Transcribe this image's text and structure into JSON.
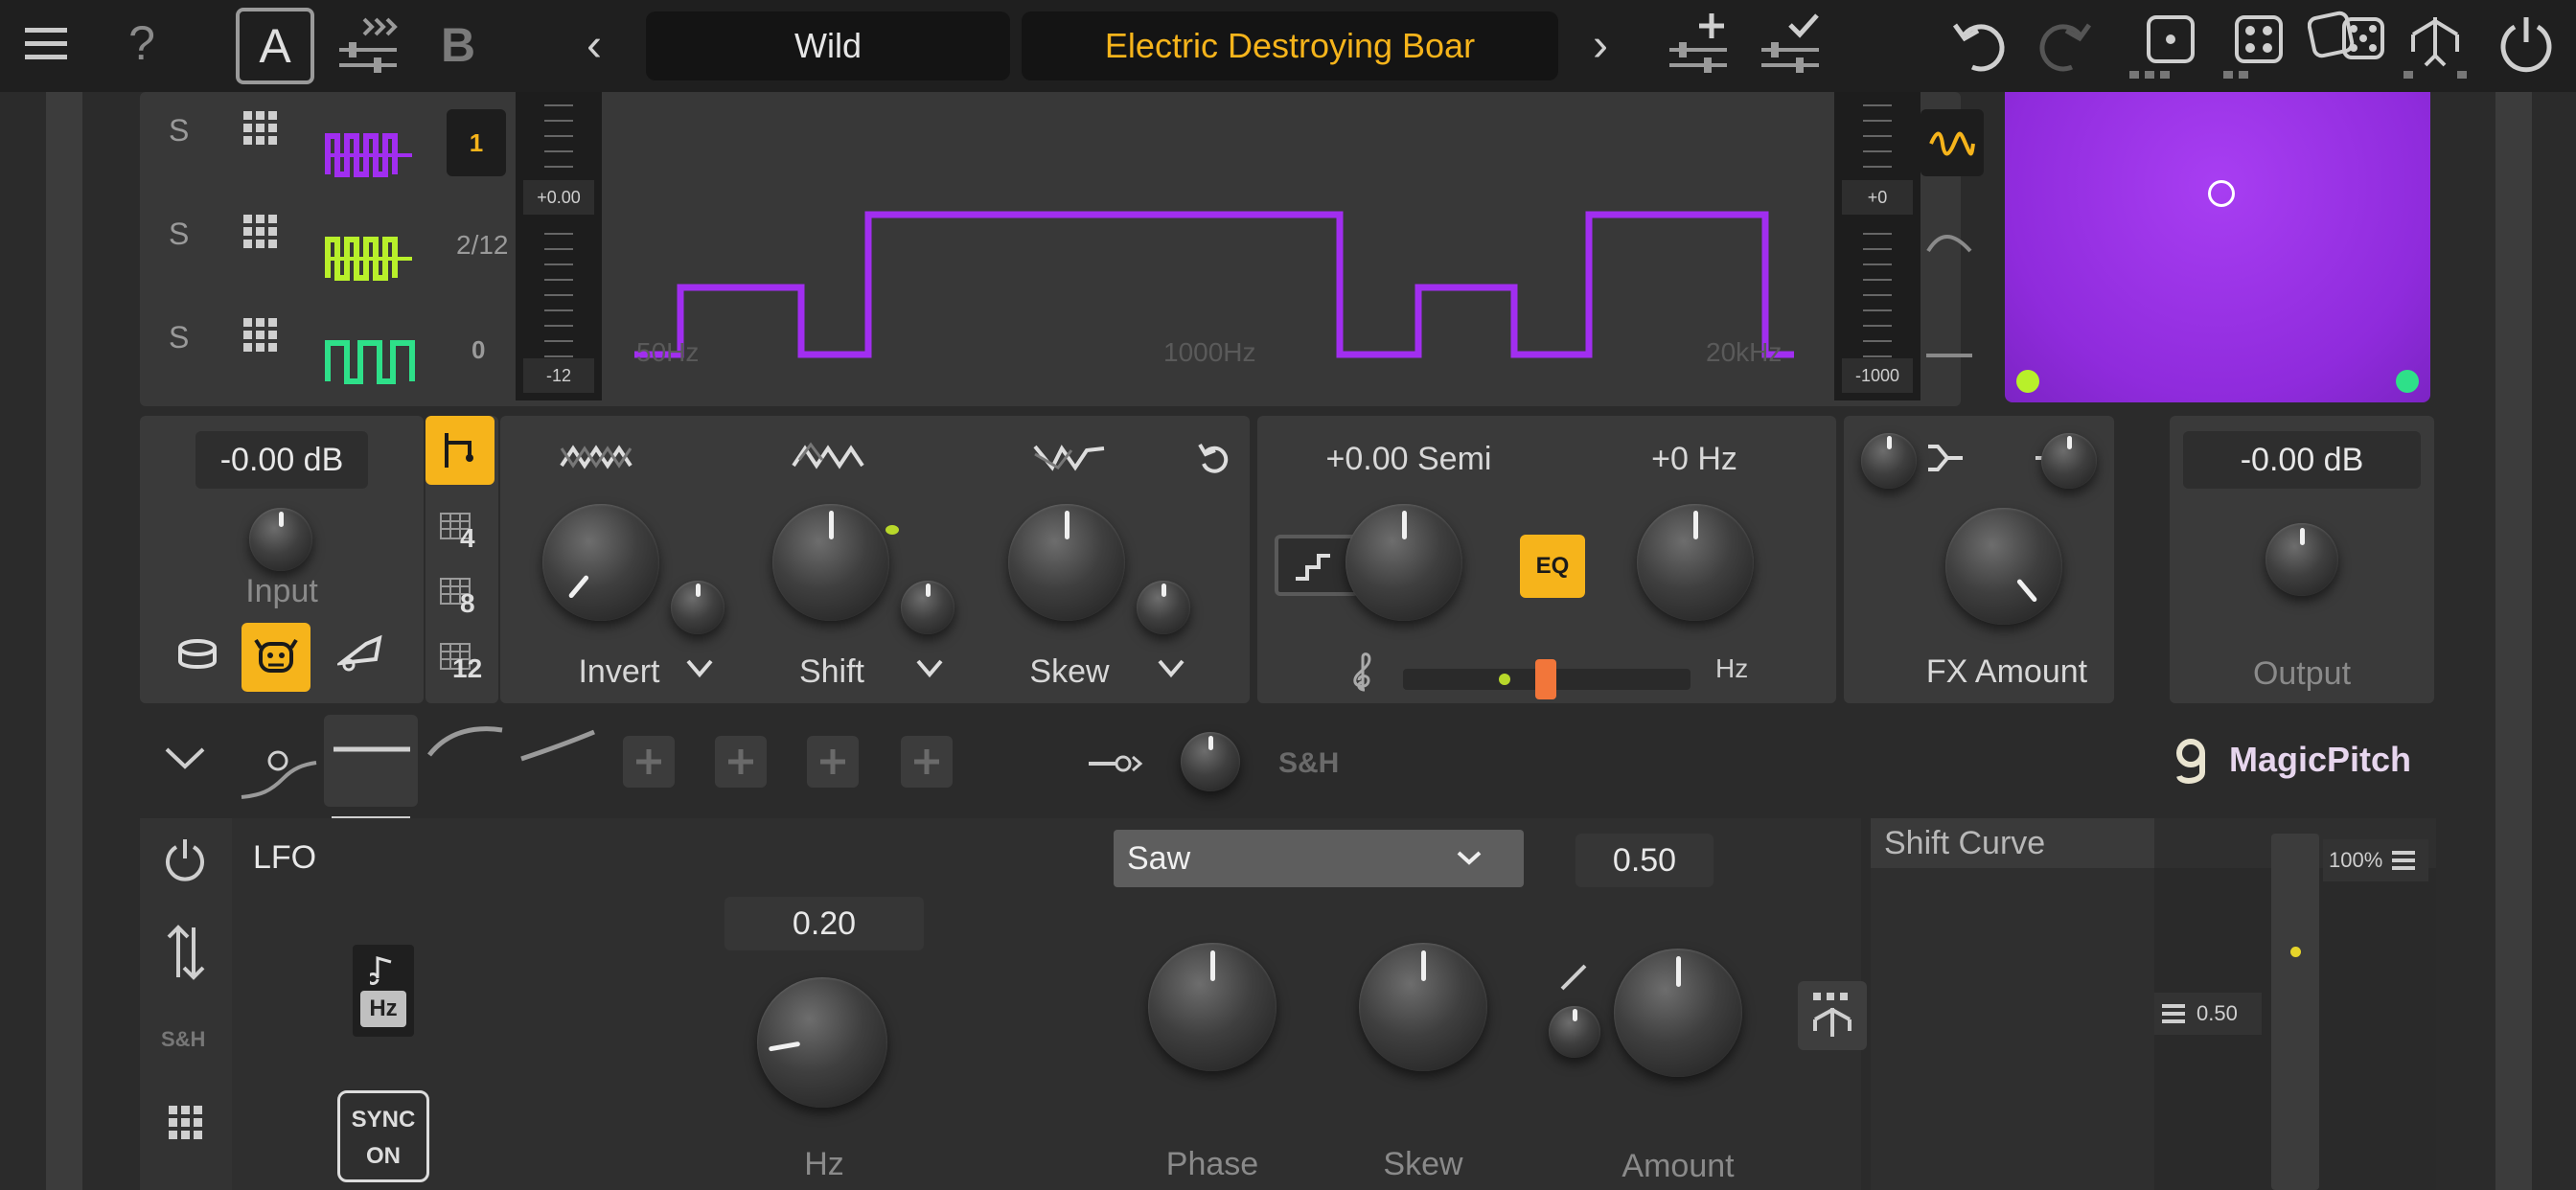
{
  "topbar": {
    "ab_a": "A",
    "ab_b": "B",
    "bank_name": "Wild",
    "preset_name": "Electric Destroying Boar",
    "help": "?",
    "prev": "‹",
    "next": "›"
  },
  "bands": {
    "rows": [
      {
        "solo": "S",
        "level": "1",
        "color": "#a12ef0"
      },
      {
        "solo": "S",
        "level": "2/12",
        "color": "#b8f02a"
      },
      {
        "solo": "S",
        "level": "0",
        "color": "#2ee089"
      }
    ],
    "left_meter": {
      "top": "+0.00",
      "bottom": "-12"
    },
    "right_meter": {
      "top": "+0",
      "bottom": "-1000"
    },
    "freq_labels": [
      "50Hz",
      "1000Hz",
      "20kHz"
    ]
  },
  "input": {
    "value": "-0.00 dB",
    "label": "Input"
  },
  "divisions": [
    "4",
    "8",
    "12"
  ],
  "shaper": {
    "invert_label": "Invert",
    "shift_label": "Shift",
    "skew_label": "Skew"
  },
  "pitch": {
    "semi_value": "+0.00 Semi",
    "hz_value": "+0 Hz",
    "eq_label": "EQ",
    "hz_unit": "Hz"
  },
  "fx": {
    "label": "FX Amount"
  },
  "output": {
    "value": "-0.00 dB",
    "label": "Output"
  },
  "mod": {
    "sh_label": "S&H",
    "brand": "MagicPitch"
  },
  "lfo": {
    "title": "LFO",
    "rate_value": "0.20",
    "rate_label": "Hz",
    "shape_select": "Saw",
    "amount_value": "0.50",
    "phase_label": "Phase",
    "skew_label": "Skew",
    "amount_label": "Amount",
    "side_sh": "S&H",
    "sync_line1": "SYNC",
    "sync_line2": "ON",
    "note_hz": "Hz"
  },
  "curve": {
    "title": "Shift Curve",
    "pct": "100%",
    "mid": "0.50"
  },
  "colors": {
    "accent": "#f6b41b",
    "xy_pad": "#9a2fe6",
    "curve_line": "#a12ef0"
  }
}
